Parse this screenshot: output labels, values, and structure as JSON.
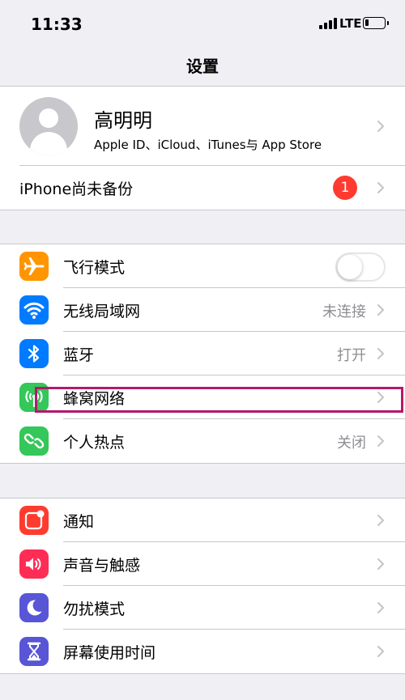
{
  "status_bar": {
    "time": "11:33",
    "network": "LTE",
    "battery_level": 0.2
  },
  "nav": {
    "title": "设置"
  },
  "profile": {
    "name": "高明明",
    "subtitle": "Apple ID、iCloud、iTunes与 App Store",
    "avatar_icon": "person-icon"
  },
  "backup": {
    "label": "iPhone尚未备份",
    "badge": "1"
  },
  "connectivity": {
    "airplane": {
      "label": "飞行模式",
      "icon": "airplane-icon",
      "color": "#ff9500",
      "toggle_on": false
    },
    "wifi": {
      "label": "无线局域网",
      "value": "未连接",
      "icon": "wifi-icon",
      "color": "#007aff"
    },
    "bluetooth": {
      "label": "蓝牙",
      "value": "打开",
      "icon": "bluetooth-icon",
      "color": "#007aff"
    },
    "cellular": {
      "label": "蜂窝网络",
      "icon": "cellular-icon",
      "color": "#34c759"
    },
    "hotspot": {
      "label": "个人热点",
      "value": "关闭",
      "icon": "hotspot-icon",
      "color": "#34c759"
    }
  },
  "general": {
    "notifications": {
      "label": "通知",
      "icon": "notifications-icon",
      "color": "#ff3b30"
    },
    "sounds": {
      "label": "声音与触感",
      "icon": "speaker-icon",
      "color": "#ff2d55"
    },
    "dnd": {
      "label": "勿扰模式",
      "icon": "moon-icon",
      "color": "#5856d6"
    },
    "screen_time": {
      "label": "屏幕使用时间",
      "icon": "hourglass-icon",
      "color": "#5856d6"
    }
  },
  "annotation": {
    "highlight_color": "#b4186c"
  }
}
